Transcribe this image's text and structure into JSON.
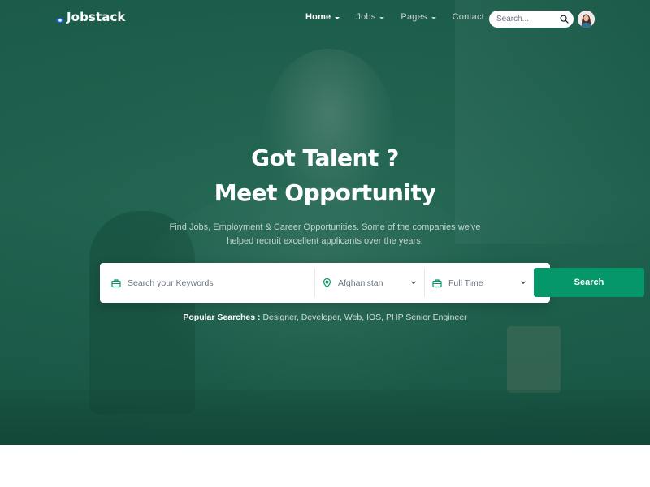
{
  "brand": {
    "name": "Jobstack",
    "accent_color": "#059669",
    "logo_icon": "logo-mark-icon"
  },
  "nav": {
    "items": [
      {
        "label": "Home",
        "has_dropdown": true,
        "active": true
      },
      {
        "label": "Jobs",
        "has_dropdown": true,
        "active": false
      },
      {
        "label": "Pages",
        "has_dropdown": true,
        "active": false
      },
      {
        "label": "Contact",
        "has_dropdown": false,
        "active": false
      }
    ],
    "search": {
      "placeholder": "Search...",
      "icon": "search-icon"
    },
    "avatar_icon": "user-avatar"
  },
  "hero": {
    "title_line1": "Got Talent ?",
    "title_line2": "Meet Opportunity",
    "subtitle": "Find Jobs, Employment & Career Opportunities. Some of the companies we've helped recruit excellent applicants over the years.",
    "overlay_color": "#1b5c4a"
  },
  "search_form": {
    "keyword_placeholder": "Search your Keywords",
    "location_value": "Afghanistan",
    "job_type_value": "Full Time",
    "button_label": "Search",
    "icons": {
      "keyword": "briefcase-icon",
      "location": "map-pin-icon",
      "type": "briefcase-icon",
      "dropdown": "chevron-down-icon"
    }
  },
  "popular_searches": {
    "label": "Popular Searches :",
    "items": "Designer, Developer, Web, IOS, PHP Senior Engineer"
  }
}
